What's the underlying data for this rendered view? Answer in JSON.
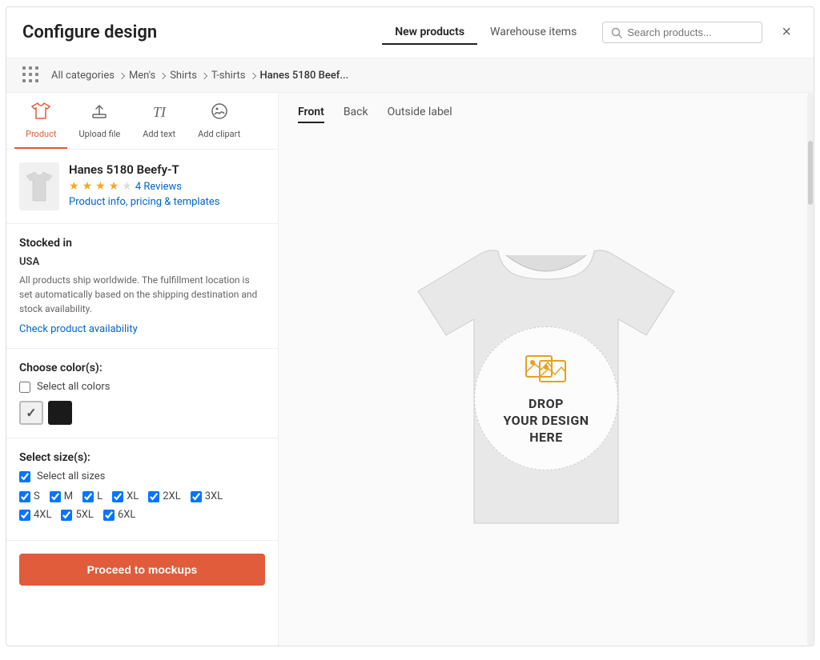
{
  "modal": {
    "title": "Configure design",
    "close_label": "×"
  },
  "header": {
    "tab_new": "New products",
    "tab_warehouse": "Warehouse items",
    "search_placeholder": "Search products..."
  },
  "breadcrumb": {
    "all_categories": "All categories",
    "mens": "Men's",
    "shirts": "Shirts",
    "tshirts": "T-shirts",
    "current": "Hanes 5180 Beef..."
  },
  "toolbar": {
    "product_label": "Product",
    "upload_label": "Upload file",
    "text_label": "Add text",
    "clipart_label": "Add clipart"
  },
  "product": {
    "name": "Hanes 5180 Beefy-T",
    "reviews_count": "4 Reviews",
    "info_link": "Product info, pricing & templates",
    "stars": 4
  },
  "stocked": {
    "title": "Stocked in",
    "location": "USA",
    "description": "All products ship worldwide. The fulfillment location is set automatically based on the shipping destination and stock availability.",
    "check_link": "Check product availability"
  },
  "colors": {
    "title": "Choose color(s):",
    "select_all": "Select all colors",
    "swatches": [
      {
        "id": "white",
        "color": "#e8e8e8",
        "selected": true,
        "dark_check": false
      },
      {
        "id": "black",
        "color": "#1a1a1a",
        "selected": false,
        "dark_check": false
      }
    ]
  },
  "sizes": {
    "title": "Select size(s):",
    "select_all": "Select all sizes",
    "rows": [
      [
        "S",
        "M",
        "L",
        "XL",
        "2XL",
        "3XL"
      ],
      [
        "4XL",
        "5XL",
        "6XL"
      ]
    ]
  },
  "proceed_btn": "Proceed to mockups",
  "views": {
    "front": "Front",
    "back": "Back",
    "outside_label": "Outside label"
  },
  "drop_zone": {
    "line1": "DROP",
    "line2": "YOUR DESIGN",
    "line3": "HERE"
  }
}
